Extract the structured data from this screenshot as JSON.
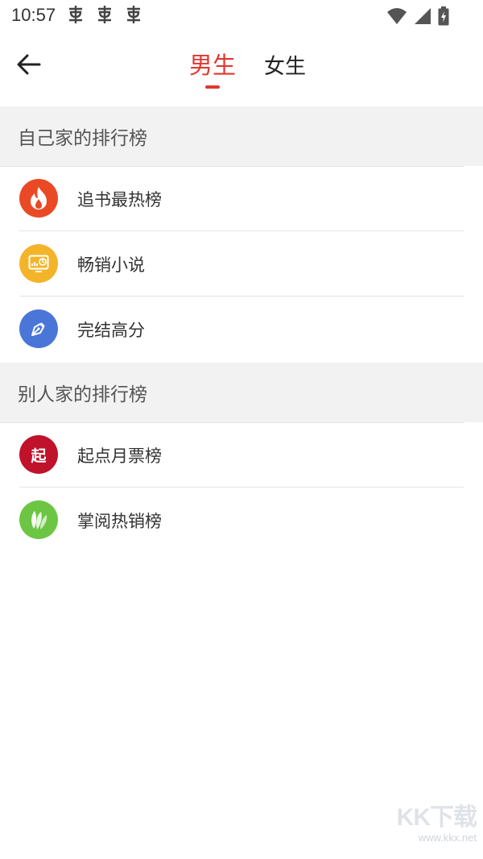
{
  "status_bar": {
    "time": "10:57"
  },
  "header": {
    "tabs": [
      {
        "label": "男生",
        "active": true
      },
      {
        "label": "女生",
        "active": false
      }
    ]
  },
  "sections": [
    {
      "title": "自己家的排行榜",
      "items": [
        {
          "label": "追书最热榜",
          "icon": "flame-icon",
          "color": "#e94a25"
        },
        {
          "label": "畅销小说",
          "icon": "sales-chart-icon",
          "color": "#f4b42a"
        },
        {
          "label": "完结高分",
          "icon": "pen-nib-icon",
          "color": "#4a76d8"
        }
      ]
    },
    {
      "title": "别人家的排行榜",
      "items": [
        {
          "label": "起点月票榜",
          "icon": "qidian-logo-icon",
          "icon_text": "起",
          "color": "#c0122a"
        },
        {
          "label": "掌阅热销榜",
          "icon": "zhangyue-leaf-icon",
          "color": "#6cc644"
        }
      ]
    }
  ],
  "colors": {
    "accent": "#e2372f",
    "section_bg": "#f2f2f2",
    "divider": "#e4e4e4"
  },
  "watermark": {
    "logo": "KK下载",
    "url": "www.kkx.net"
  }
}
